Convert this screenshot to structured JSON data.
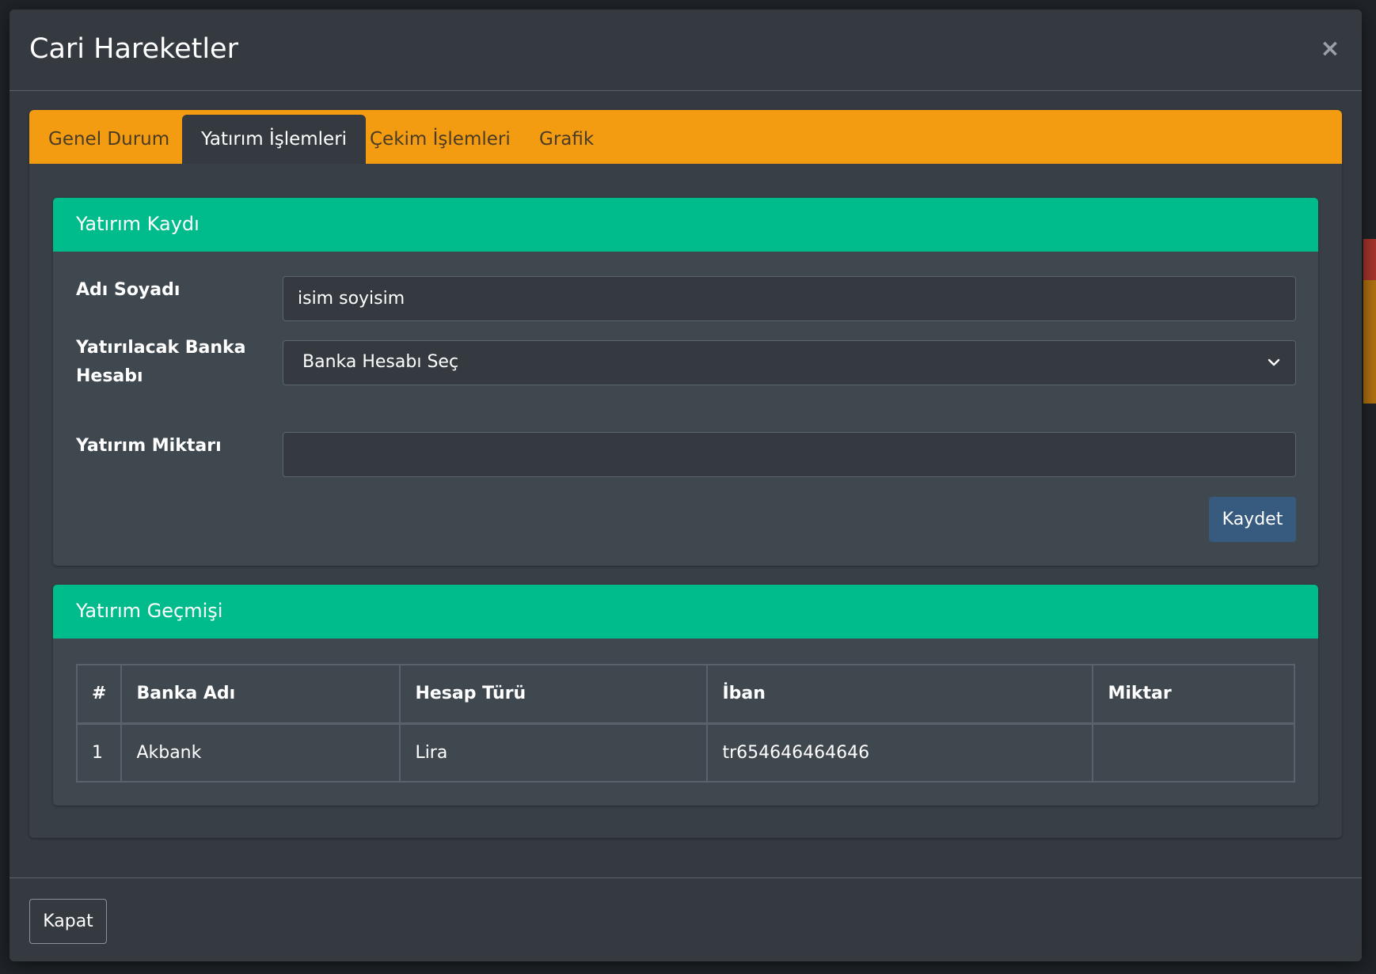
{
  "modal": {
    "title": "Cari Hareketler",
    "close_symbol": "×",
    "close_icon": "close-icon"
  },
  "tabs": [
    {
      "label": "Genel Durum",
      "active": false
    },
    {
      "label": "Yatırım İşlemleri",
      "active": true
    },
    {
      "label": "Çekim İşlemleri",
      "active": false
    },
    {
      "label": "Grafik",
      "active": false
    }
  ],
  "deposit_form": {
    "title": "Yatırım Kaydı",
    "name_label": "Adı Soyadı",
    "name_value": "isim soyisim",
    "bank_label": "Yatırılacak Banka Hesabı",
    "bank_selected": "Banka Hesabı Seç",
    "amount_label": "Yatırım Miktarı",
    "amount_value": "",
    "save_label": "Kaydet"
  },
  "history": {
    "title": "Yatırım Geçmişi",
    "columns": [
      "#",
      "Banka Adı",
      "Hesap Türü",
      "İban",
      "Miktar"
    ],
    "rows": [
      [
        "1",
        "Akbank",
        "Lira",
        "tr654646464646",
        ""
      ]
    ]
  },
  "footer": {
    "close_label": "Kapat"
  },
  "colors": {
    "tab_bar": "#f39c12",
    "panel_header": "#00bc8c",
    "primary_button": "#375a7f",
    "modal_bg": "#343a40"
  }
}
